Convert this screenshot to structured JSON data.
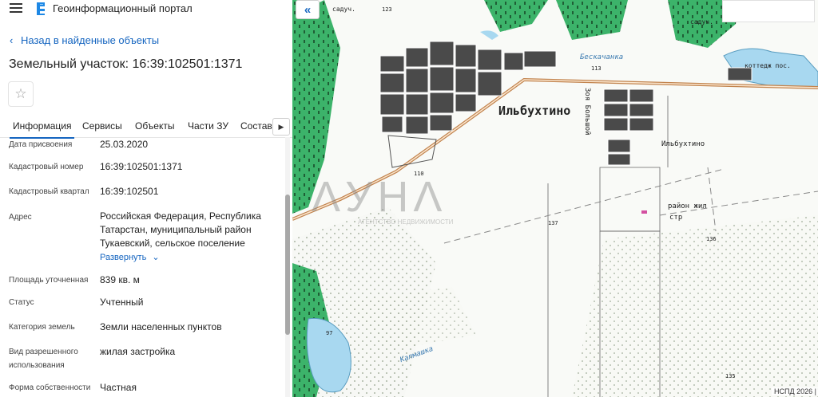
{
  "app": {
    "title": "Геоинформационный портал"
  },
  "nav": {
    "back_label": "Назад в найденные объекты"
  },
  "parcel": {
    "title": "Земельный участок: 16:39:102501:1371"
  },
  "tabs": [
    {
      "label": "Информация",
      "active": true
    },
    {
      "label": "Сервисы"
    },
    {
      "label": "Объекты"
    },
    {
      "label": "Части ЗУ"
    },
    {
      "label": "Состав"
    }
  ],
  "attributes": {
    "date": {
      "label": "Дата присвоения",
      "value": "25.03.2020"
    },
    "cadastral_number": {
      "label": "Кадастровый номер",
      "value": "16:39:102501:1371"
    },
    "cadastral_block": {
      "label": "Кадастровый квартал",
      "value": "16:39:102501"
    },
    "address": {
      "label": "Адрес",
      "value_line1": "Российская Федерация, Республика",
      "value_line2": "Татарстан, муниципальный район",
      "value_line3": "Тукаевский, сельское поселение",
      "expand_label": "Развернуть"
    },
    "area": {
      "label": "Площадь уточненная",
      "value": "839 кв. м"
    },
    "status": {
      "label": "Статус",
      "value": "Учтенный"
    },
    "land_category": {
      "label": "Категория земель",
      "value": "Земли населенных пунктов"
    },
    "permitted_use": {
      "label_line1": "Вид разрешенного",
      "label_line2": "использования",
      "value": "жилая застройка"
    },
    "ownership": {
      "label": "Форма собственности",
      "value": "Частная"
    }
  },
  "map": {
    "village_label": "Ильбухтино",
    "small_village_label": "Ильбухтино",
    "street_label": "Зоя Большой",
    "zone_label_line1": "район жил",
    "zone_label_line2": "стр",
    "river1": "Бескачанка",
    "river2": "Калмашка",
    "cottage_label": "коттедж пос.",
    "garden_label_1": "садуч.",
    "garden_label_2": "садуч.",
    "copyright": "НСПД 2026 |",
    "watermark": {
      "main": "ΛУНΛ",
      "sub": "АГЕНТСТВО НЕДВИЖИМОСТИ"
    },
    "numbers": [
      "123",
      "113",
      "137",
      "136",
      "97",
      "135",
      "110"
    ],
    "colors": {
      "forest": "#3cb36a",
      "water": "#a8d8f0",
      "road": "#c2844f",
      "building": "#444444",
      "background": "#f9faf7"
    }
  }
}
